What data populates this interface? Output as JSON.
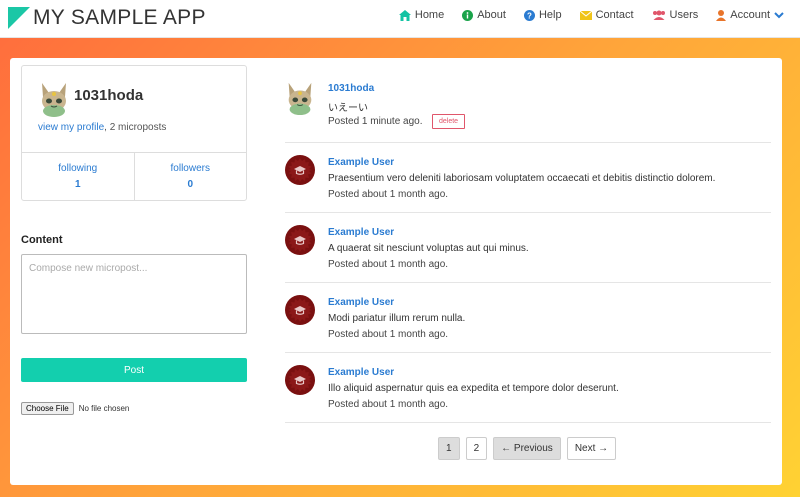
{
  "app": {
    "title": "MY SAMPLE APP"
  },
  "nav": [
    {
      "label": "Home",
      "icon": "home-icon",
      "color": "#13c3a3"
    },
    {
      "label": "About",
      "icon": "info-icon",
      "color": "#1aa34a"
    },
    {
      "label": "Help",
      "icon": "help-icon",
      "color": "#2a7bd1"
    },
    {
      "label": "Contact",
      "icon": "envelope-icon",
      "color": "#f0c419"
    },
    {
      "label": "Users",
      "icon": "users-icon",
      "color": "#e0566b"
    },
    {
      "label": "Account",
      "icon": "user-icon",
      "color": "#e8742a"
    }
  ],
  "profile": {
    "username": "1031hoda",
    "view_profile": "view my profile",
    "microposts": ", 2 microposts",
    "following_label": "following",
    "following_count": "1",
    "followers_label": "followers",
    "followers_count": "0"
  },
  "compose": {
    "label": "Content",
    "placeholder": "Compose new micropost...",
    "post_button": "Post",
    "file_button": "Choose File",
    "file_status": "No file chosen"
  },
  "feed": [
    {
      "user": "1031hoda",
      "text": "いえーい",
      "time": "Posted 1 minute ago.",
      "delete": "delete"
    },
    {
      "user": "Example User",
      "text": "Praesentium vero deleniti laboriosam voluptatem occaecati et debitis distinctio dolorem.",
      "time": "Posted about 1 month ago."
    },
    {
      "user": "Example User",
      "text": "A quaerat sit nesciunt voluptas aut qui minus.",
      "time": "Posted about 1 month ago."
    },
    {
      "user": "Example User",
      "text": "Modi pariatur illum rerum nulla.",
      "time": "Posted about 1 month ago."
    },
    {
      "user": "Example User",
      "text": "Illo aliquid aspernatur quis ea expedita et tempore dolor deserunt.",
      "time": "Posted about 1 month ago."
    }
  ],
  "pagination": {
    "page1": "1",
    "page2": "2",
    "previous": "← Previous",
    "next": "Next →"
  }
}
